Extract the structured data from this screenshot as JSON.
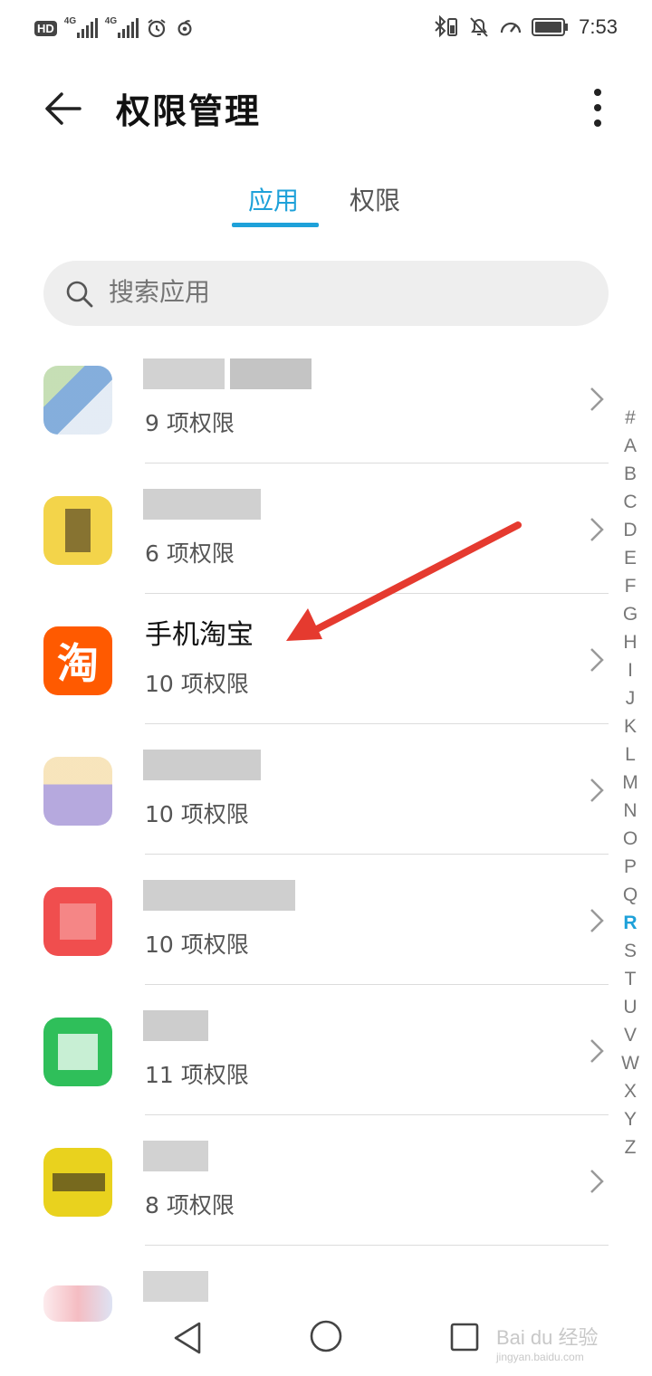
{
  "status_bar": {
    "hd_label": "HD",
    "network_1": "4G",
    "network_2": "4G",
    "time": "7:53"
  },
  "header": {
    "title": "权限管理",
    "back_icon": "back-arrow-icon",
    "more_icon": "more-vertical-icon"
  },
  "tabs": [
    {
      "label": "应用",
      "selected": true
    },
    {
      "label": "权限",
      "selected": false
    }
  ],
  "search": {
    "placeholder": "搜索应用"
  },
  "apps": [
    {
      "name": "",
      "perms": "9 项权限",
      "icon_color": "#8fb7d8",
      "blurred": true
    },
    {
      "name": "",
      "perms": "6 项权限",
      "icon_color": "#f3d44a",
      "blurred": true
    },
    {
      "name": "手机淘宝",
      "perms": "10 项权限",
      "icon_color": "#ff5a00",
      "icon_text": "淘",
      "blurred": false
    },
    {
      "name": "",
      "perms": "10 项权限",
      "icon_color": "#a99ad8",
      "blurred": true
    },
    {
      "name": "",
      "perms": "10 项权限",
      "icon_color": "#ef3b3b",
      "blurred": true
    },
    {
      "name": "",
      "perms": "11 项权限",
      "icon_color": "#2fbf5a",
      "blurred": true
    },
    {
      "name": "",
      "perms": "8 项权限",
      "icon_color": "#e9d21e",
      "blurred": true
    },
    {
      "name": "",
      "perms": "",
      "icon_color": "#f0a0a8",
      "blurred": true
    }
  ],
  "alphabet_index": [
    "#",
    "A",
    "B",
    "C",
    "D",
    "E",
    "F",
    "G",
    "H",
    "I",
    "J",
    "K",
    "L",
    "M",
    "N",
    "O",
    "P",
    "Q",
    "R",
    "S",
    "T",
    "U",
    "V",
    "W",
    "X",
    "Y",
    "Z"
  ],
  "alphabet_active": "R",
  "annotation": {
    "color": "#e53a2f"
  },
  "nav_bar": {
    "back_icon": "triangle-back-icon",
    "home_icon": "circle-home-icon",
    "recent_icon": "square-recents-icon"
  },
  "watermark": {
    "main": "Bai du 经验",
    "sub": "jingyan.baidu.com"
  },
  "colors": {
    "accent": "#1ea1d9",
    "taobao": "#ff5a00"
  }
}
